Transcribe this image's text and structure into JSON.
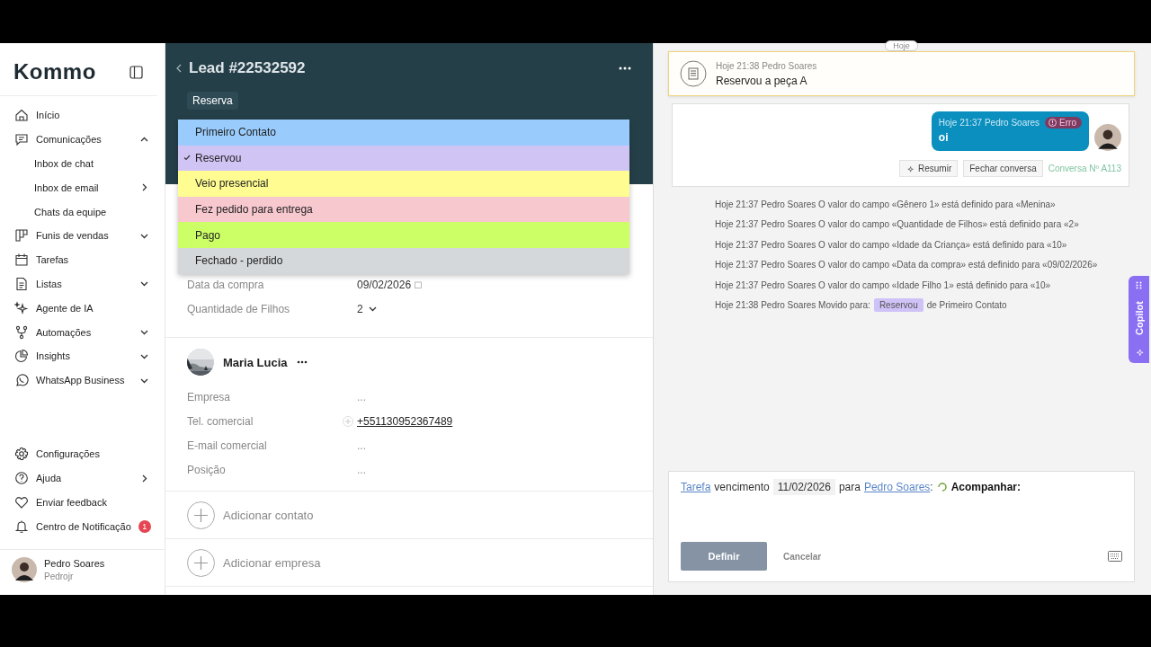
{
  "sidebar": {
    "logo": "Kommo",
    "items": [
      {
        "label": "Início"
      },
      {
        "label": "Comunicações",
        "expanded": true,
        "children": [
          {
            "label": "Inbox de chat"
          },
          {
            "label": "Inbox de email",
            "submenu": true
          },
          {
            "label": "Chats da equipe"
          }
        ]
      },
      {
        "label": "Funis de vendas",
        "expanded": false
      },
      {
        "label": "Tarefas"
      },
      {
        "label": "Listas",
        "expanded": false
      },
      {
        "label": "Agente de IA"
      },
      {
        "label": "Automações",
        "expanded": false
      },
      {
        "label": "Insights",
        "expanded": false
      },
      {
        "label": "WhatsApp Business",
        "expanded": false
      }
    ],
    "bottom_items": [
      {
        "label": "Configurações"
      },
      {
        "label": "Ajuda",
        "submenu": true
      },
      {
        "label": "Enviar feedback"
      },
      {
        "label": "Centro de Notificação",
        "badge": "1"
      }
    ],
    "user": {
      "name": "Pedro Soares",
      "login": "Pedrojr"
    }
  },
  "lead": {
    "title": "Lead #22532592",
    "tag": "Reserva",
    "stages": [
      {
        "label": "Primeiro Contato",
        "color": "#99ccfd",
        "selected": false
      },
      {
        "label": "Reservou",
        "color": "#d0c4f5",
        "selected": true
      },
      {
        "label": "Veio presencial",
        "color": "#fffd91",
        "selected": false
      },
      {
        "label": "Fez pedido para entrega",
        "color": "#f8c8cf",
        "selected": false
      },
      {
        "label": "Pago",
        "color": "#ccff66",
        "selected": false
      },
      {
        "label": "Fechado - perdido",
        "color": "#d5d8db",
        "selected": false
      }
    ],
    "fields": [
      {
        "label": "Data da compra",
        "value": "09/02/2026",
        "kind": "date"
      },
      {
        "label": "Quantidade de Filhos",
        "value": "2",
        "kind": "select"
      }
    ],
    "contact": {
      "name": "Maria Lucia",
      "fields": [
        {
          "label": "Empresa",
          "placeholder": "...",
          "kind": "empty"
        },
        {
          "label": "Tel. comercial",
          "value": "+551130952367489",
          "kind": "phone"
        },
        {
          "label": "E-mail comercial",
          "placeholder": "...",
          "kind": "empty"
        },
        {
          "label": "Posição",
          "placeholder": "...",
          "kind": "empty"
        }
      ]
    },
    "add_actions": [
      "Adicionar contato",
      "Adicionar empresa"
    ]
  },
  "feed": {
    "date_pill": "Hoje",
    "note": {
      "meta": "Hoje 21:38 Pedro Soares",
      "text": "Reservou a peça A"
    },
    "message": {
      "meta": "Hoje 21:37 Pedro Soares",
      "status": "Erro",
      "text": "oi"
    },
    "chat_actions": [
      "Resumir",
      "Fechar conversa"
    ],
    "conversation_link": "Conversa Nº A113",
    "events": [
      {
        "kind": "text",
        "text": "Hoje 21:37 Pedro Soares O valor do campo «Gênero 1» está definido para «Menina»"
      },
      {
        "kind": "text",
        "text": "Hoje 21:37 Pedro Soares O valor do campo «Quantidade de Filhos» está definido para «2»"
      },
      {
        "kind": "text",
        "text": "Hoje 21:37 Pedro Soares O valor do campo «Idade da Criança» está definido para «10»"
      },
      {
        "kind": "text",
        "text": "Hoje 21:37 Pedro Soares O valor do campo «Data da compra» está definido para «09/02/2026»"
      },
      {
        "kind": "text",
        "text": "Hoje 21:37 Pedro Soares O valor do campo «Idade Filho 1» está definido para «10»"
      },
      {
        "kind": "move",
        "text": "Hoje 21:38 Pedro Soares Movido para:",
        "tag": "Reservou",
        "suffix": "de Primeiro Contato"
      }
    ]
  },
  "task": {
    "type_link": "Tarefa",
    "due_label": "vencimento",
    "due_date": "11/02/2026",
    "for_label": "para",
    "user_link": "Pedro Soares",
    "colon": ":",
    "action": "Acompanhar:",
    "buttons": [
      "Definir",
      "Cancelar"
    ]
  },
  "copilot": "Copilot"
}
